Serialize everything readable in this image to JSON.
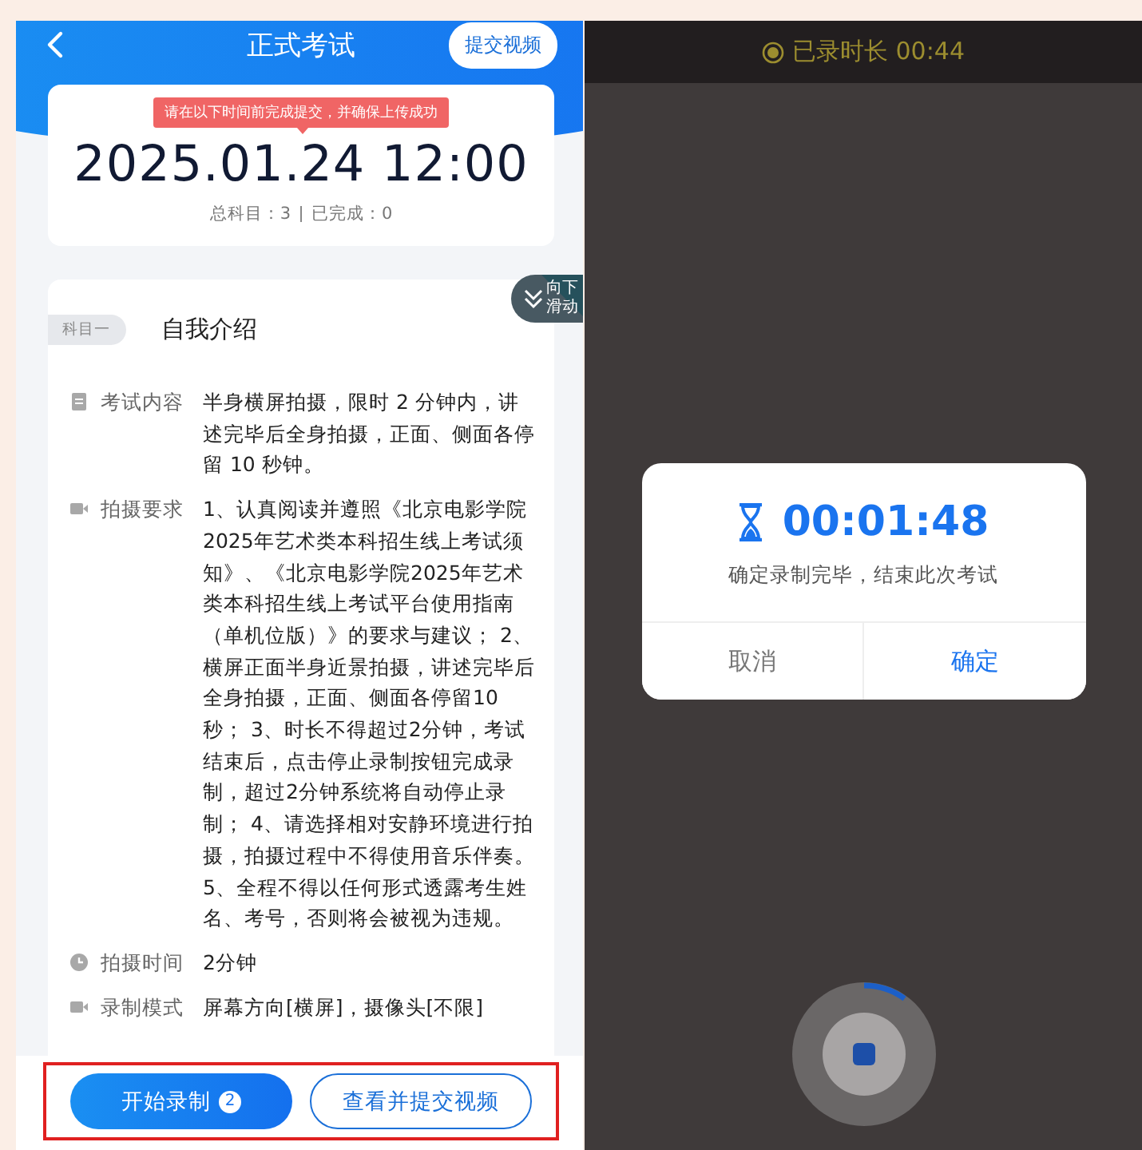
{
  "exam_screen": {
    "nav": {
      "title": "正式考试",
      "action_button": "提交视频"
    },
    "deadline_card": {
      "notice": "请在以下时间前完成提交，并确保上传成功",
      "deadline": "2025.01.24 12:00",
      "total": "总科目：3",
      "completed": "已完成：0"
    },
    "subject": {
      "tag": "科目一",
      "title": "自我介绍",
      "scroll_hint": "向下滑动"
    },
    "details": [
      {
        "kind": "document",
        "label": "考试内容",
        "value": "半身横屏拍摄，限时 2 分钟内，讲述完毕后全身拍摄，正面、侧面各停留 10 秒钟。"
      },
      {
        "kind": "video",
        "label": "拍摄要求",
        "value": "1、认真阅读并遵照《北京电影学院2025年艺术类本科招生线上考试须知》、《北京电影学院2025年艺术类本科招生线上考试平台使用指南（单机位版）》的要求与建议； 2、横屏正面半身近景拍摄，讲述完毕后全身拍摄，正面、侧面各停留10秒； 3、时长不得超过2分钟，考试结束后，点击停止录制按钮完成录制，超过2分钟系统将自动停止录制； 4、请选择相对安静环境进行拍摄，拍摄过程中不得使用音乐伴奏。 5、全程不得以任何形式透露考生姓名、考号，否则将会被视为违规。"
      },
      {
        "kind": "clock",
        "label": "拍摄时间",
        "value": "2分钟"
      },
      {
        "kind": "video",
        "label": "录制模式",
        "value": "屏幕方向[横屏]，摄像头[不限]"
      }
    ],
    "buttons": [
      {
        "kind": "primary",
        "label": "开始录制",
        "badge": "2"
      },
      {
        "kind": "outline",
        "label": "查看并提交视频"
      }
    ]
  },
  "camera_screen": {
    "recording_label": "已录时长 00:44",
    "dialog": {
      "timer": "00:01:48",
      "message": "确定录制完毕，结束此次考试",
      "buttons": [
        {
          "kind": "cancel",
          "label": "取消"
        },
        {
          "kind": "confirm",
          "label": "确定"
        }
      ]
    },
    "record_button": {
      "level": 0.1
    }
  }
}
